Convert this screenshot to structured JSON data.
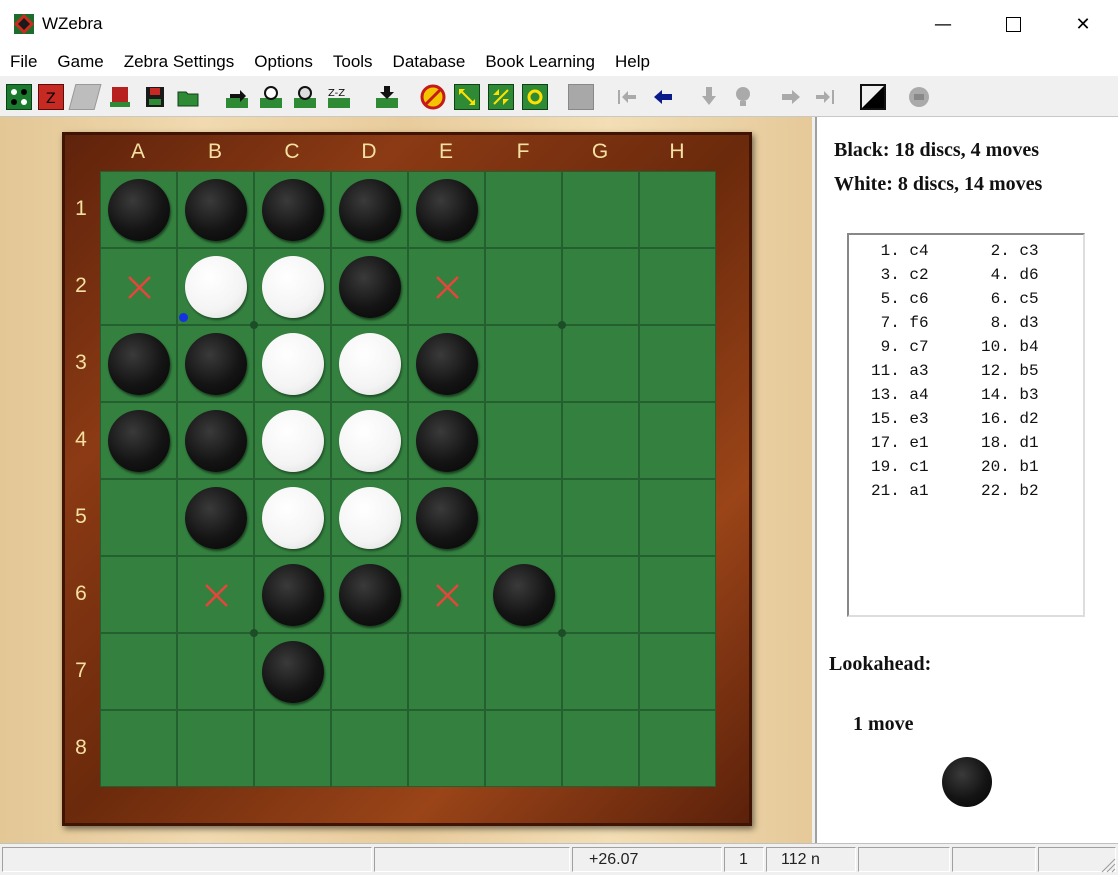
{
  "window": {
    "title": "WZebra"
  },
  "menu": [
    "File",
    "Game",
    "Zebra Settings",
    "Options",
    "Tools",
    "Database",
    "Book Learning",
    "Help"
  ],
  "toolbar_icons": [
    "new-game-icon",
    "zebra-book-icon",
    "disabled-icon",
    "open-book-icon",
    "save-icon",
    "open-folder-icon",
    "play-icon",
    "search-icon",
    "analyze-icon",
    "z-z-icon",
    "move-down-icon",
    "stop-icon",
    "expand-icon",
    "shrink-icon",
    "refresh-icon",
    "blank-icon",
    "first-move-icon",
    "prev-move-icon",
    "down-icon",
    "hint-icon",
    "next-move-icon",
    "last-move-icon",
    "flip-board-icon",
    "stop-zebra-icon"
  ],
  "board": {
    "columns": [
      "A",
      "B",
      "C",
      "D",
      "E",
      "F",
      "G",
      "H"
    ],
    "rows": [
      "1",
      "2",
      "3",
      "4",
      "5",
      "6",
      "7",
      "8"
    ],
    "cells": [
      [
        "B",
        "B",
        "B",
        "B",
        "B",
        "",
        "",
        ""
      ],
      [
        "X",
        "W",
        "W",
        "B",
        "X",
        "",
        "",
        ""
      ],
      [
        "B",
        "B",
        "W",
        "W",
        "B",
        "",
        "",
        ""
      ],
      [
        "B",
        "B",
        "W",
        "W",
        "B",
        "",
        "",
        ""
      ],
      [
        "",
        "B",
        "W",
        "W",
        "B",
        "",
        "",
        ""
      ],
      [
        "",
        "X",
        "B",
        "B",
        "X",
        "B",
        "",
        ""
      ],
      [
        "",
        "",
        "B",
        "",
        "",
        "",
        "",
        ""
      ],
      [
        "",
        "",
        "",
        "",
        "",
        "",
        "",
        ""
      ]
    ],
    "legend": {
      "B": "black disc",
      "W": "white disc",
      "X": "red x mark"
    }
  },
  "side": {
    "black": "Black:  18 discs, 4 moves",
    "white": "White:  8 discs, 14 moves",
    "moves": [
      [
        " 1. c4",
        " 2. c3"
      ],
      [
        " 3. c2",
        " 4. d6"
      ],
      [
        " 5. c6",
        " 6. c5"
      ],
      [
        " 7. f6",
        " 8. d3"
      ],
      [
        " 9. c7",
        "10. b4"
      ],
      [
        "11. a3",
        "12. b5"
      ],
      [
        "13. a4",
        "14. b3"
      ],
      [
        "15. e3",
        "16. d2"
      ],
      [
        "17. e1",
        "18. d1"
      ],
      [
        "19. c1",
        "20. b1"
      ],
      [
        "21. a1",
        "22. b2"
      ]
    ],
    "lookahead_label": "Lookahead:",
    "lookahead_value": "1 move"
  },
  "status": {
    "eval": "+26.07",
    "depth": "1",
    "nodes": "112 n"
  }
}
